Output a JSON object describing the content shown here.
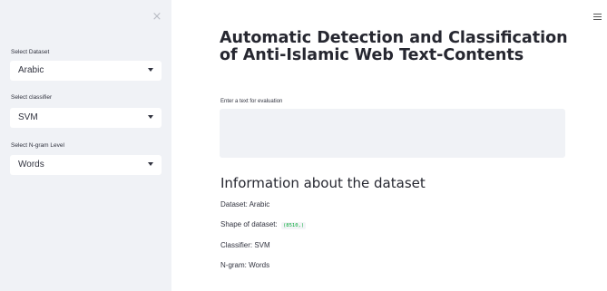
{
  "sidebar": {
    "close_glyph": "×",
    "dataset": {
      "label": "Select Dataset",
      "value": "Arabic"
    },
    "classifier": {
      "label": "Select classifier",
      "value": "SVM"
    },
    "ngram": {
      "label": "Select N-gram Level",
      "value": "Words"
    }
  },
  "main": {
    "title": "Automatic Detection and Classification of Anti-Islamic Web Text-Contents",
    "input_label": "Enter a text for evaluation",
    "input_value": "",
    "info_header": "Information about the dataset",
    "dataset_line": "Dataset: Arabic",
    "shape_label": "Shape of dataset:",
    "shape_value": "(8510,)",
    "classifier_line": "Classifier: SVM",
    "ngram_line": "N-gram: Words"
  },
  "colors": {
    "sidebar_bg": "#f0f2f6",
    "code_green": "#09ab3b",
    "text": "#262730"
  }
}
